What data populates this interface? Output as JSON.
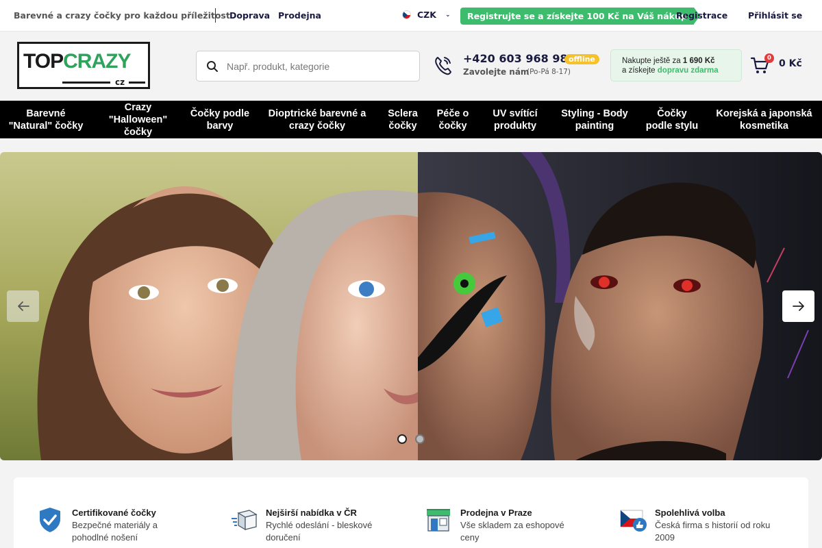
{
  "topbar": {
    "tagline": "Barevné a crazy čočky pro každou příležitost",
    "links": [
      "Doprava",
      "Prodejna"
    ],
    "currency": "CZK",
    "promo": "Registrujte se a získejte 100 Kč na Váš nákup",
    "register": "Registrace",
    "login": "Přihlásit se"
  },
  "header": {
    "logo": {
      "top": "TOP",
      "crazy": "CRAZY",
      "cz": "cz"
    },
    "search_placeholder": "Např. produkt, kategorie",
    "phone": "+420 603 968 981",
    "status": "offline",
    "call_label": "Zavolejte nám",
    "hours": "(Po-Pá 8-17)",
    "freeship": {
      "line1": "Nakupte ještě za",
      "amount": "1 690 Kč",
      "line2": "a získejte",
      "highlight": "dopravu zdarma"
    },
    "cart_count": "0",
    "cart_total": "0 Kč"
  },
  "categories": [
    {
      "line1": "Barevné",
      "line2": "\"Natural\" čočky"
    },
    {
      "line1": "Crazy",
      "line2": "\"Halloween\"",
      "line3": "čočky"
    },
    {
      "line1": "Čočky podle",
      "line2": "barvy"
    },
    {
      "line1": "Dioptrické barevné a",
      "line2": "crazy čočky"
    },
    {
      "line1": "Sclera",
      "line2": "čočky"
    },
    {
      "line1": "Péče o",
      "line2": "čočky"
    },
    {
      "line1": "UV svítící",
      "line2": "produkty"
    },
    {
      "line1": "Styling - Body",
      "line2": "painting"
    },
    {
      "line1": "Čočky",
      "line2": "podle stylu"
    },
    {
      "line1": "Korejská a japonská",
      "line2": "kosmetika"
    }
  ],
  "slider": {
    "slides": 2,
    "active_slide": 1
  },
  "features": [
    {
      "title": "Certifikované čočky",
      "desc": "Bezpečné materiály a pohodlné nošení",
      "icon": "shield-check-icon"
    },
    {
      "title": "Nejširší nabídka v ČR",
      "desc": "Rychlé odeslání - bleskové doručení",
      "icon": "fast-box-icon"
    },
    {
      "title": "Prodejna v Praze",
      "desc": "Vše skladem za eshopové ceny",
      "icon": "store-icon"
    },
    {
      "title": "Spolehlivá volba",
      "desc": "Česká firma s historií od roku 2009",
      "icon": "czech-flag-thumb-icon"
    }
  ],
  "colors": {
    "accent_green": "#3ebc6d",
    "nav_bg": "#000000",
    "offline_badge": "#f6c22b",
    "cart_badge": "#e23b3b"
  }
}
